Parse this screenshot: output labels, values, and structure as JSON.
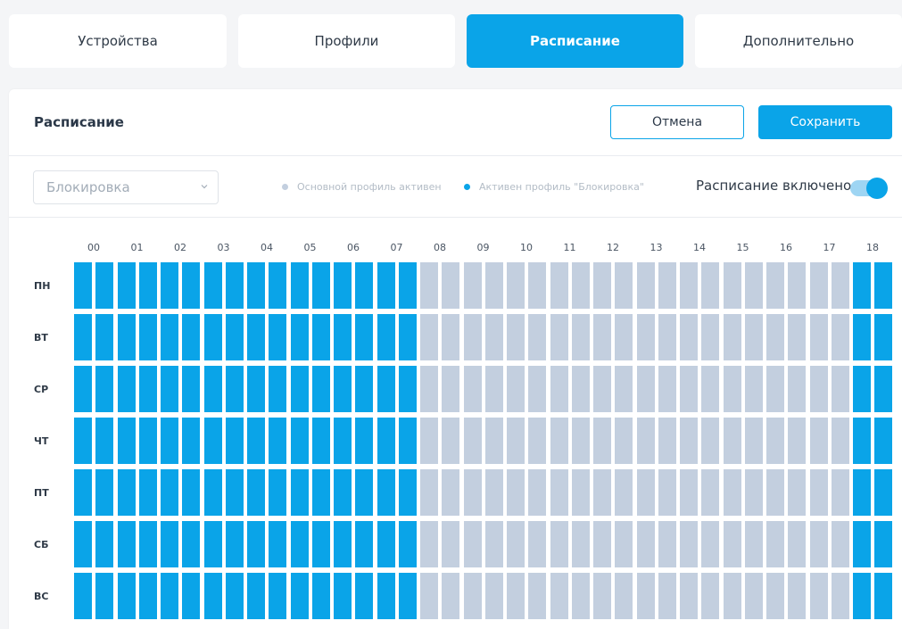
{
  "tabs": [
    {
      "label": "Устройства",
      "active": false
    },
    {
      "label": "Профили",
      "active": false
    },
    {
      "label": "Расписание",
      "active": true
    },
    {
      "label": "Дополнительно",
      "active": false
    }
  ],
  "header": {
    "title": "Расписание",
    "cancel_label": "Отмена",
    "save_label": "Сохранить"
  },
  "controls": {
    "profile_select": "Блокировка",
    "legend": [
      {
        "label": "Основной профиль активен",
        "color": "#c3cfdf"
      },
      {
        "label": "Активен профиль \"Блокировка\"",
        "color": "#0aa4e8"
      }
    ],
    "schedule_enabled_label": "Расписание включено",
    "schedule_enabled": true
  },
  "colors": {
    "accent": "#0aa4e8",
    "inactive_cell": "#c3cfdf"
  },
  "grid": {
    "hours": [
      "00",
      "01",
      "02",
      "03",
      "04",
      "05",
      "06",
      "07",
      "08",
      "09",
      "10",
      "11",
      "12",
      "13",
      "14",
      "15",
      "16",
      "17",
      "18"
    ],
    "days": [
      "ПН",
      "ВТ",
      "СР",
      "ЧТ",
      "ПТ",
      "СБ",
      "ВС"
    ],
    "active_hours": [
      "00",
      "01",
      "02",
      "03",
      "04",
      "05",
      "06",
      "07",
      "18"
    ]
  }
}
